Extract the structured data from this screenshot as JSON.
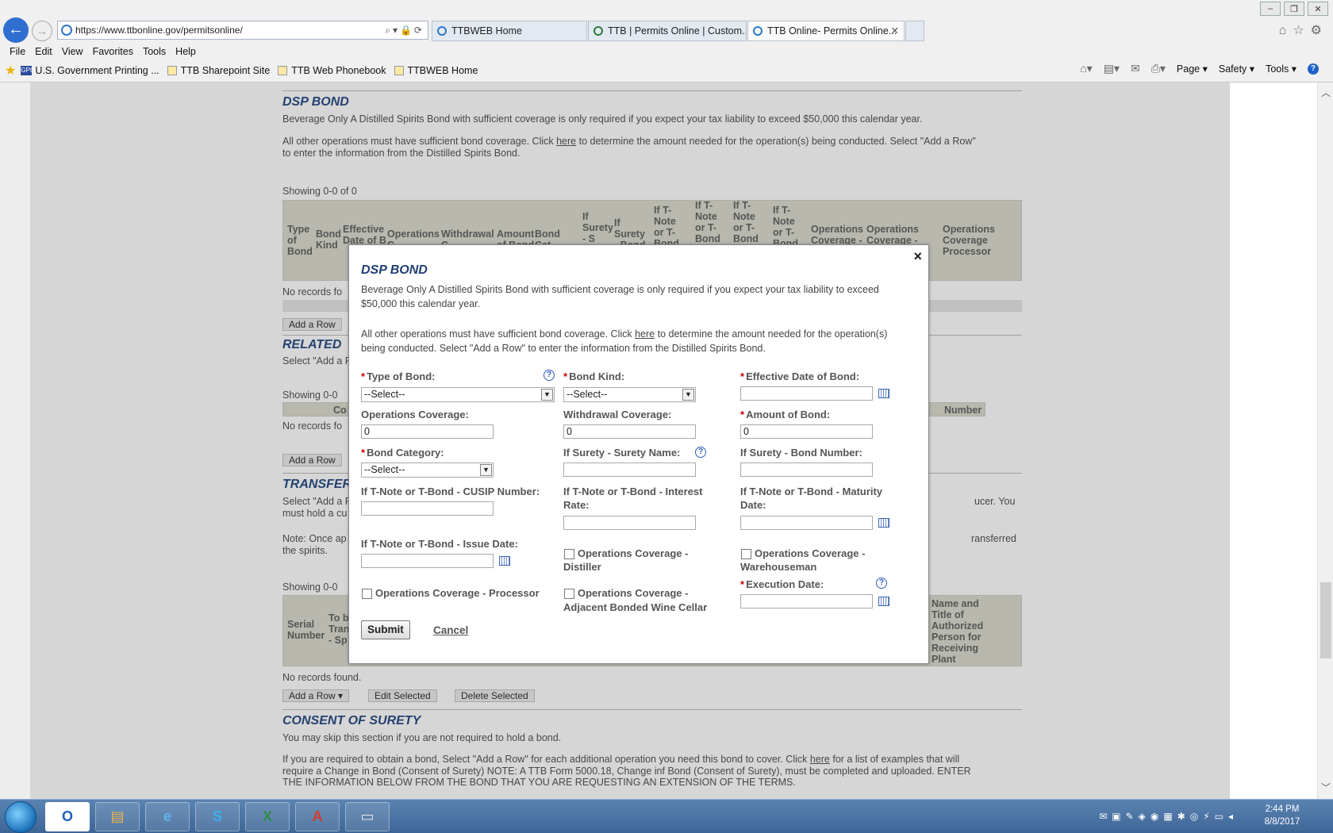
{
  "browser": {
    "url": "https://www.ttbonline.gov/permitsonline/",
    "tabs": [
      "TTBWEB Home",
      "TTB | Permits Online | Custom...",
      "TTB Online- Permits Online..."
    ],
    "menu": [
      "File",
      "Edit",
      "View",
      "Favorites",
      "Tools",
      "Help"
    ],
    "favorites": [
      "U.S. Government Printing ...",
      "TTB Sharepoint Site",
      "TTB Web Phonebook",
      "TTBWEB Home"
    ],
    "gpo_badge": "GPO",
    "command_bar": [
      "Page",
      "Safety",
      "Tools"
    ]
  },
  "background": {
    "dsp_title": "DSP BOND",
    "dsp_p1": "Beverage Only  A Distilled Spirits Bond with sufficient coverage is only required if you expect your tax liability to exceed $50,000 this calendar year.",
    "dsp_p2a": "All other operations must have sufficient bond coverage. Click ",
    "dsp_p2_link": "here",
    "dsp_p2b": " to determine the amount needed for the operation(s) being conducted. Select \"Add a Row\"",
    "dsp_p2c": "to enter the information from the Distilled Spirits Bond.",
    "showing": "Showing 0-0 of 0",
    "showing_short": "Showing 0-0",
    "grid_cols": [
      "Type of Bond",
      "Bond Kind",
      "Effective Date of B",
      "Operations C",
      "Withdrawal C",
      "Amount of Bond",
      "Bond Cat",
      "If Surety - S",
      "If Surety - Bond",
      "If T-Note or T-Bond",
      "If T-Note or T-Bond",
      "If T-Note or T-Bond",
      "If T-Note or T-Bond",
      "Operations Coverage -",
      "Operations Coverage -",
      "Operations Coverage Processor"
    ],
    "no_records_short": "No records fo",
    "add_row": "Add a Row",
    "related_title": "RELATED",
    "related_text": "Select \"Add a R",
    "cos_col": "Co",
    "number_col": "Number",
    "transfer_title": "TRANSFER",
    "transfer_text1": "Select \"Add a F",
    "transfer_text1_right": "ucer. You",
    "transfer_text2": "must hold a cu",
    "transfer_note": "Note: Once ap",
    "transfer_note_right": "ransferred",
    "transfer_note2": "the spirits.",
    "serial_number": "Serial Number",
    "to_be_transferred": "To b Tran - Sp",
    "name_title": "Name and Title of Authorized Person for Receiving Plant",
    "no_records_found": "No records found.",
    "edit_selected": "Edit Selected",
    "delete_selected": "Delete Selected",
    "consent_title": "CONSENT OF SURETY",
    "consent_p1": "You may skip this section if you are not required to hold a bond.",
    "consent_p2a": "If you are required to obtain a bond, Select \"Add a Row\" for each additional operation you need this bond to cover. Click ",
    "consent_p2_link": "here",
    "consent_p2b": " for a list of examples that will",
    "consent_p3": "require a Change in Bond (Consent of Surety) NOTE: A TTB Form 5000.18, Change inf Bond (Consent of Surety), must be completed and uploaded. ENTER",
    "consent_p4": "THE INFORMATION BELOW FROM THE BOND THAT YOU ARE REQUESTING AN EXTENSION OF THE TERMS."
  },
  "modal": {
    "close": "×",
    "title": "DSP BOND",
    "p1a": "Beverage Only  A Distilled Spirits Bond with sufficient coverage is only required if you expect your tax liability to exceed",
    "p1b": "$50,000 this calendar year.",
    "p2a": "All other operations must have sufficient bond coverage. Click ",
    "p2_link": "here",
    "p2b": " to determine the amount needed for the operation(s)",
    "p2c": "being conducted. Select \"Add a Row\" to enter the information from the Distilled Spirits Bond.",
    "required_mark": "*",
    "help_glyph": "?",
    "fields": {
      "type_of_bond": {
        "label": "Type of Bond:",
        "value": "--Select--"
      },
      "bond_kind": {
        "label": "Bond Kind:",
        "value": "--Select--"
      },
      "effective_date": {
        "label": "Effective Date of Bond:",
        "value": ""
      },
      "operations_coverage": {
        "label": "Operations Coverage:",
        "value": "0"
      },
      "withdrawal_coverage": {
        "label": "Withdrawal Coverage:",
        "value": "0"
      },
      "amount_of_bond": {
        "label": "Amount of Bond:",
        "value": "0"
      },
      "bond_category": {
        "label": "Bond Category:",
        "value": "--Select--"
      },
      "surety_name": {
        "label": "If Surety - Surety Name:",
        "value": ""
      },
      "surety_bond_number": {
        "label": "If Surety - Bond Number:",
        "value": ""
      },
      "cusip": {
        "label": "If T-Note or T-Bond - CUSIP Number:",
        "value": ""
      },
      "interest_rate": {
        "label_1": "If T-Note or T-Bond - Interest",
        "label_2": "Rate:",
        "value": ""
      },
      "maturity_date": {
        "label_1": "If T-Note or T-Bond - Maturity",
        "label_2": "Date:",
        "value": ""
      },
      "issue_date": {
        "label": "If T-Note or T-Bond - Issue Date:",
        "value": ""
      },
      "cov_distiller": {
        "label_1": "Operations Coverage -",
        "label_2": "Distiller",
        "checked": false
      },
      "cov_warehouseman": {
        "label_1": "Operations Coverage -",
        "label_2": "Warehouseman",
        "checked": false
      },
      "cov_processor": {
        "label": "Operations Coverage - Processor",
        "checked": false
      },
      "cov_wine_cellar": {
        "label_1": "Operations Coverage -",
        "label_2": "Adjacent Bonded Wine Cellar",
        "checked": false
      },
      "execution_date": {
        "label": "Execution Date:",
        "value": ""
      }
    },
    "submit": "Submit",
    "cancel": "Cancel"
  },
  "taskbar": {
    "apps": [
      "outlook-icon",
      "file-explorer-icon",
      "internet-explorer-icon",
      "skype-icon",
      "excel-icon",
      "acrobat-icon",
      "window-icon"
    ],
    "time": "2:44 PM",
    "date": "8/8/2017"
  }
}
